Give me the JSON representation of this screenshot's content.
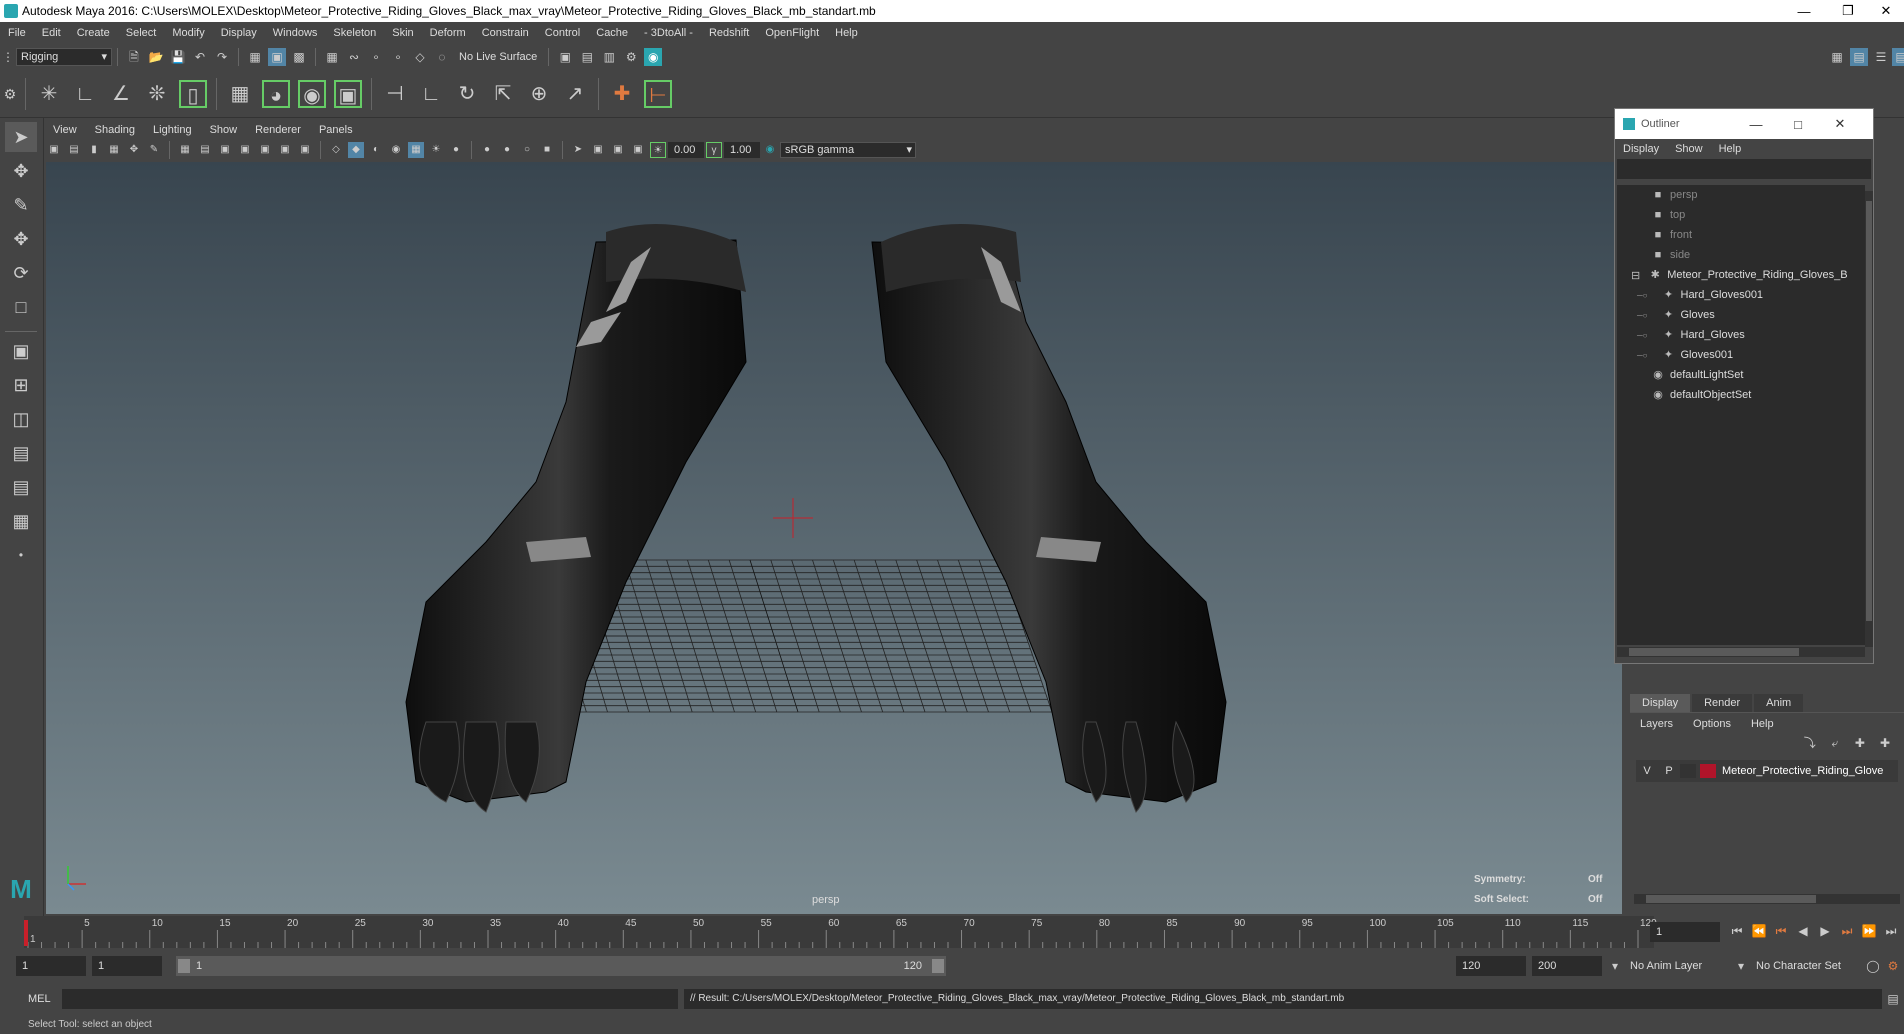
{
  "title_bar": {
    "title": "Autodesk Maya 2016: C:\\Users\\MOLEX\\Desktop\\Meteor_Protective_Riding_Gloves_Black_max_vray\\Meteor_Protective_Riding_Gloves_Black_mb_standart.mb"
  },
  "menus": [
    "File",
    "Edit",
    "Create",
    "Select",
    "Modify",
    "Display",
    "Windows",
    "Skeleton",
    "Skin",
    "Deform",
    "Constrain",
    "Control",
    "Cache",
    "- 3DtoAll -",
    "Redshift",
    "OpenFlight",
    "Help"
  ],
  "status_line": {
    "mode": "Rigging",
    "live_surface": "No Live Surface"
  },
  "viewport_menu": [
    "View",
    "Shading",
    "Lighting",
    "Show",
    "Renderer",
    "Panels"
  ],
  "viewport_toolbar": {
    "value1": "0.00",
    "value2": "1.00",
    "color_space": "sRGB gamma"
  },
  "viewport": {
    "camera_label": "persp",
    "symmetry_label": "Symmetry:",
    "symmetry_value": "Off",
    "soft_select_label": "Soft Select:",
    "soft_select_value": "Off"
  },
  "outliner": {
    "title": "Outliner",
    "menu": [
      "Display",
      "Show",
      "Help"
    ],
    "items": [
      {
        "label": "persp",
        "indent": 1,
        "icon": "camera-icon",
        "dim": true
      },
      {
        "label": "top",
        "indent": 1,
        "icon": "camera-icon",
        "dim": true
      },
      {
        "label": "front",
        "indent": 1,
        "icon": "camera-icon",
        "dim": true
      },
      {
        "label": "side",
        "indent": 1,
        "icon": "camera-icon",
        "dim": true
      },
      {
        "label": "Meteor_Protective_Riding_Gloves_B",
        "indent": 0,
        "icon": "group-icon",
        "dim": false,
        "expanded": true
      },
      {
        "label": "Hard_Gloves001",
        "indent": 2,
        "icon": "mesh-icon",
        "dim": false
      },
      {
        "label": "Gloves",
        "indent": 2,
        "icon": "mesh-icon",
        "dim": false
      },
      {
        "label": "Hard_Gloves",
        "indent": 2,
        "icon": "mesh-icon",
        "dim": false
      },
      {
        "label": "Gloves001",
        "indent": 2,
        "icon": "mesh-icon",
        "dim": false
      },
      {
        "label": "defaultLightSet",
        "indent": 1,
        "icon": "set-icon",
        "dim": false
      },
      {
        "label": "defaultObjectSet",
        "indent": 1,
        "icon": "set-icon",
        "dim": false
      }
    ]
  },
  "layer_editor": {
    "tabs": [
      "Display",
      "Render",
      "Anim"
    ],
    "menu": [
      "Layers",
      "Options",
      "Help"
    ],
    "layer": {
      "v": "V",
      "p": "P",
      "name": "Meteor_Protective_Riding_Glove",
      "color": "#b0142a"
    }
  },
  "timeline": {
    "ticks": [
      "1",
      "5",
      "10",
      "15",
      "20",
      "25",
      "30",
      "35",
      "40",
      "45",
      "50",
      "55",
      "60",
      "65",
      "70",
      "75",
      "80",
      "85",
      "90",
      "95",
      "100",
      "105",
      "110",
      "115",
      "120"
    ],
    "current_frame": "1"
  },
  "range": {
    "start": "1",
    "anim_start": "1",
    "range_start": "1",
    "range_end": "120",
    "anim_end": "120",
    "end": "200",
    "anim_layer": "No Anim Layer",
    "character_set": "No Character Set"
  },
  "command_line": {
    "label": "MEL",
    "result": "// Result: C:/Users/MOLEX/Desktop/Meteor_Protective_Riding_Gloves_Black_max_vray/Meteor_Protective_Riding_Gloves_Black_mb_standart.mb"
  },
  "help_line": "Select Tool: select an object",
  "colors": {
    "accent": "#5285a6",
    "red_marker": "#c8202a",
    "panel": "#444444",
    "field": "#2b2b2b"
  }
}
